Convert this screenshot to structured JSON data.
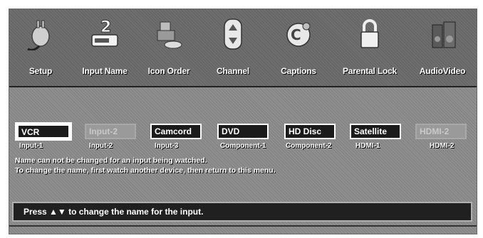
{
  "menu": {
    "items": [
      {
        "label": "Setup",
        "icon": "plug-icon"
      },
      {
        "label": "Input Name",
        "icon": "input-name-icon"
      },
      {
        "label": "Icon Order",
        "icon": "icon-order-icon"
      },
      {
        "label": "Channel",
        "icon": "channel-updown-icon"
      },
      {
        "label": "Captions",
        "icon": "captions-icon"
      },
      {
        "label": "Parental Lock",
        "icon": "padlock-icon"
      },
      {
        "label": "AudioVideo",
        "icon": "audio-video-icon"
      }
    ]
  },
  "inputs": [
    {
      "name": "VCR",
      "label": "Input-1",
      "state": "selected"
    },
    {
      "name": "Input-2",
      "label": "Input-2",
      "state": "disabled"
    },
    {
      "name": "Camcord",
      "label": "Input-3",
      "state": "normal"
    },
    {
      "name": "DVD",
      "label": "Component-1",
      "state": "normal"
    },
    {
      "name": "HD Disc",
      "label": "Component-2",
      "state": "normal"
    },
    {
      "name": "Satellite",
      "label": "HDMI-1",
      "state": "normal"
    },
    {
      "name": "HDMI-2",
      "label": "HDMI-2",
      "state": "disabled"
    }
  ],
  "notes": {
    "line1": "Name can not be changed for an input being watched.",
    "line2": "To change the name, first watch another device, then return to this menu."
  },
  "status": {
    "text": "Press ▲▼ to change the name for the input."
  },
  "colors": {
    "background": "#8f8f8f",
    "box": "#1b1b1b",
    "text": "#ffffff"
  }
}
